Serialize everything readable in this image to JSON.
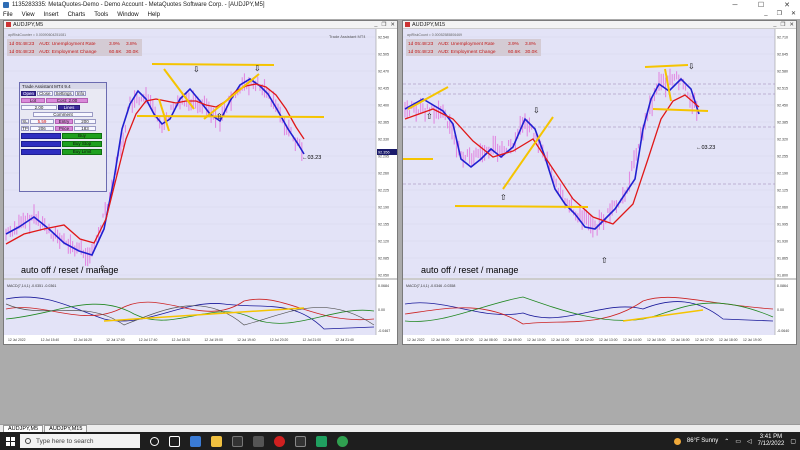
{
  "window": {
    "title": "1135283335: MetaQuotes-Demo - Demo Account - MetaQuotes Software Corp. - [AUDJPY,M5]",
    "controls": {
      "minimize": "─",
      "maximize": "☐",
      "close": "✕"
    }
  },
  "menu": [
    "File",
    "View",
    "Insert",
    "Charts",
    "Tools",
    "Window",
    "Help"
  ],
  "mdi": {
    "minimize": "_",
    "restore": "❐",
    "close": "✕"
  },
  "charts": [
    {
      "title": "AUDJPY,M5",
      "info_line": "apiRiskCounter = 0.00090604251081",
      "news": [
        {
          "time": "1d 05:48:23",
          "event": "AUD: Unemployment Rate",
          "actual": "3.9%",
          "forecast": "3.8%"
        },
        {
          "time": "1d 05:48:23",
          "event": "AUD: Employment Change",
          "actual": "60.6K",
          "forecast": "30.0K"
        }
      ],
      "watermark": "Trade Assistant MT4",
      "price_ticks": [
        "92.540",
        "92.505",
        "92.470",
        "92.435",
        "92.400",
        "92.365",
        "92.330",
        "92.295",
        "92.260",
        "92.225",
        "92.190",
        "92.155",
        "92.120",
        "92.085",
        "92.050"
      ],
      "current_price": "92.356",
      "countdown": "←03.23",
      "time_ticks": [
        "12 Jul 2022",
        "12 Jul 15:40",
        "12 Jul 16:20",
        "12 Jul 17:00",
        "12 Jul 17:40",
        "12 Jul 18:20",
        "12 Jul 19:00",
        "12 Jul 19:40",
        "12 Jul 20:20",
        "12 Jul 21:00",
        "12 Jul 21:40"
      ],
      "macd_label": "MACD(7,14,1) -0.0351 -0.0361",
      "macd_ticks": [
        "0.0684",
        "0.00",
        "-0.0467"
      ],
      "auto_label": "auto off / reset / manage"
    },
    {
      "title": "AUDJPY,M15",
      "info_line": "apiRiskCount = 0.00052585806469",
      "news": [
        {
          "time": "1d 05:48:23",
          "event": "AUD: Unemployment Rate",
          "actual": "3.9%",
          "forecast": "3.8%"
        },
        {
          "time": "1d 05:48:23",
          "event": "AUD: Employment Change",
          "actual": "60.6K",
          "forecast": "30.0K"
        }
      ],
      "price_ticks": [
        "92.710",
        "92.645",
        "92.580",
        "92.515",
        "92.450",
        "92.385",
        "92.320",
        "92.255",
        "92.190",
        "92.125",
        "92.060",
        "91.995",
        "91.930",
        "91.865",
        "91.800"
      ],
      "countdown": "←03.23",
      "time_ticks": [
        "12 Jul 2022",
        "12 Jul 06:00",
        "12 Jul 07:00",
        "12 Jul 08:00",
        "12 Jul 09:00",
        "12 Jul 10:00",
        "12 Jul 11:00",
        "12 Jul 12:00",
        "12 Jul 13:00",
        "12 Jul 14:00",
        "12 Jul 15:00",
        "12 Jul 16:00",
        "12 Jul 17:00",
        "12 Jul 18:00",
        "12 Jul 19:00"
      ],
      "macd_label": "MACD(7,14,1) -0.0346 -0.0358",
      "macd_ticks": [
        "0.0864",
        "0.00",
        "-0.0640"
      ],
      "auto_label": "auto off / reset / manage"
    }
  ],
  "trade_panel": {
    "title": "Trade Assistant MT4 9.4",
    "tabs": [
      "Open",
      "Close",
      "Settings",
      "Info"
    ],
    "lot_label": "Lot",
    "cost": "Cost: 2.00",
    "risk_value": "2.00",
    "lines_label": "Lines",
    "comment_label": "Comment",
    "sl_label": "SL",
    "sl_value": "5.59",
    "entry_label": "Entry",
    "entry_value": "200",
    "tp_label": "TP",
    "tp_value": "206",
    "price_label": "Price",
    "price_value": "183",
    "buy_labels": [
      "Buy",
      "Buy Stop",
      "Buy Limit"
    ],
    "colors": {
      "dark": "#3b2a9a",
      "pink": "#d98ad9",
      "blue": "#2e2ec0",
      "green": "#1fa01f"
    }
  },
  "tabs": [
    "AUDJPY,M5",
    "AUDJPY,M15"
  ],
  "taskbar": {
    "search_placeholder": "Type here to search",
    "weather": "86°F  Sunny",
    "time": "3:41 PM",
    "date": "7/12/2022"
  },
  "colors": {
    "chart_bg": "#e3e3f7",
    "candle_pink": "#e28ae2",
    "ma_fast": "#2020d0",
    "ma_slow": "#e01818",
    "trend_yellow": "#f5c400"
  }
}
